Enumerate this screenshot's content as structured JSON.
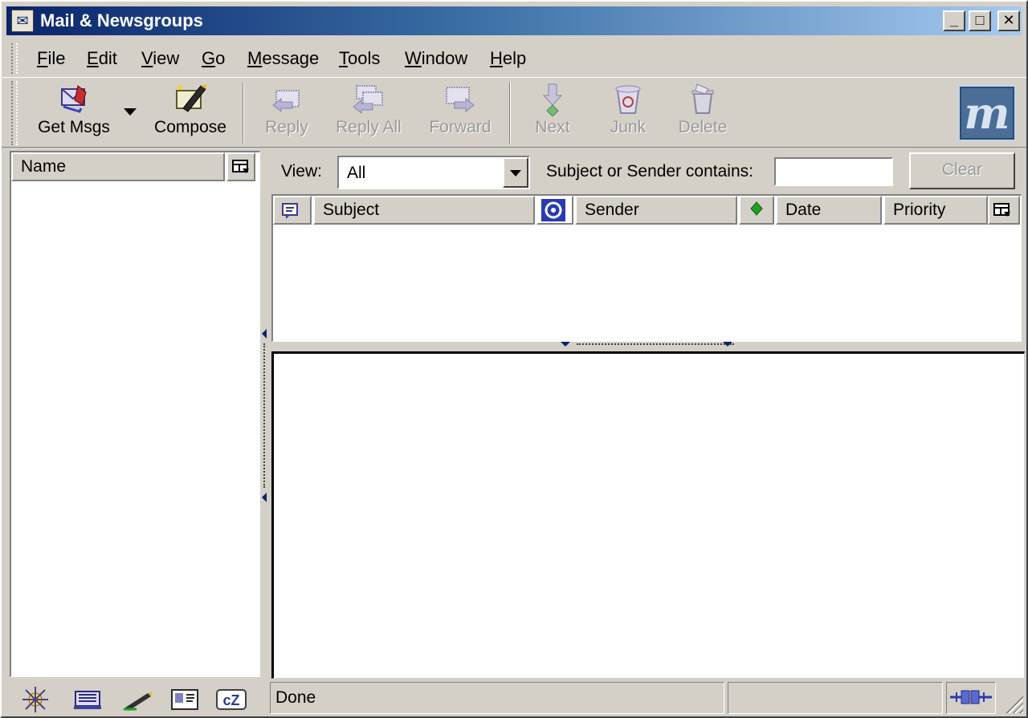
{
  "window": {
    "title": "Mail & Newsgroups",
    "minimize": "_",
    "maximize": "□",
    "close": "✕"
  },
  "menu": [
    "File",
    "Edit",
    "View",
    "Go",
    "Message",
    "Tools",
    "Window",
    "Help"
  ],
  "toolbar": {
    "get_msgs": "Get Msgs",
    "compose": "Compose",
    "reply": "Reply",
    "reply_all": "Reply All",
    "forward": "Forward",
    "next": "Next",
    "junk": "Junk",
    "delete": "Delete",
    "logo": "m"
  },
  "folder_pane": {
    "header": "Name"
  },
  "search": {
    "view_label": "View:",
    "view_value": "All",
    "contains_label": "Subject or Sender contains:",
    "query": "",
    "clear": "Clear"
  },
  "thread_columns": {
    "subject": "Subject",
    "sender": "Sender",
    "date": "Date",
    "priority": "Priority"
  },
  "status": {
    "text": "Done"
  },
  "colors": {
    "chrome": "#d4d0c8",
    "title_start": "#0a246a",
    "title_end": "#a6caf0"
  }
}
